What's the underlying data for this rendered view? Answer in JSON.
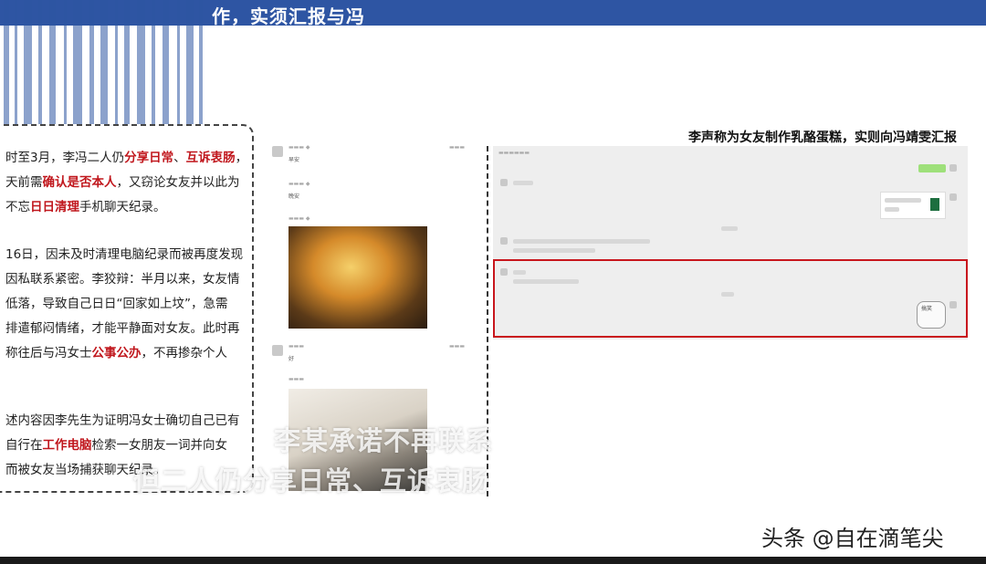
{
  "header": {
    "title": "作，实须汇报与冯"
  },
  "article": {
    "paragraphs": [
      {
        "lines": [
          [
            {
              "t": "时至3月，李冯二人仍"
            },
            {
              "t": "分享日常",
              "hl": true
            },
            {
              "t": "、"
            },
            {
              "t": "互诉衷肠",
              "hl": true
            },
            {
              "t": "，"
            }
          ],
          [
            {
              "t": "天前需"
            },
            {
              "t": "确认是否本人",
              "hl": true
            },
            {
              "t": "，又窃论女友并以此为"
            }
          ],
          [
            {
              "t": "不忘"
            },
            {
              "t": "日日清理",
              "hl": true
            },
            {
              "t": "手机聊天纪录。"
            }
          ]
        ]
      },
      {
        "lines": [
          [
            {
              "t": "16日，因未及时清理电脑纪录而被再度发现"
            }
          ],
          [
            {
              "t": "因私联系紧密。李狡辩：半月以来，女友情"
            }
          ],
          [
            {
              "t": "低落，导致自己日日“回家如上坟”，急需"
            }
          ],
          [
            {
              "t": "排遣郁闷情绪，才能平静面对女友。此时再"
            }
          ],
          [
            {
              "t": "称往后与冯女士"
            },
            {
              "t": "公事公办",
              "hl": true
            },
            {
              "t": "，不再掺杂个人"
            }
          ]
        ]
      },
      {
        "lines": [
          [
            {
              "t": "述内容因李先生为证明冯女士确切自己已有"
            }
          ],
          [
            {
              "t": "自行在"
            },
            {
              "t": "工作电脑",
              "hl": true
            },
            {
              "t": "检索一女朋友一词并向女"
            }
          ],
          [
            {
              "t": "而被女友当场捕获聊天纪录。"
            }
          ]
        ]
      }
    ]
  },
  "chat_left": {
    "msg1": "早安",
    "msg2": "晚安",
    "msg3": "好"
  },
  "right_panel": {
    "caption": "李声称为女友制作乳酪蛋糕，实则向冯靖雯汇报",
    "sticker_text": "搞笑"
  },
  "subtitles": {
    "line1": "李某承诺不再联系",
    "line2": "但二人仍分享日常、互诉衷肠"
  },
  "watermark": "头条 @自在滴笔尖",
  "colors": {
    "accent_blue": "#2e55a3",
    "highlight_red": "#c0161c",
    "box_red": "#c8161d",
    "bubble_green": "#9ee07a"
  }
}
